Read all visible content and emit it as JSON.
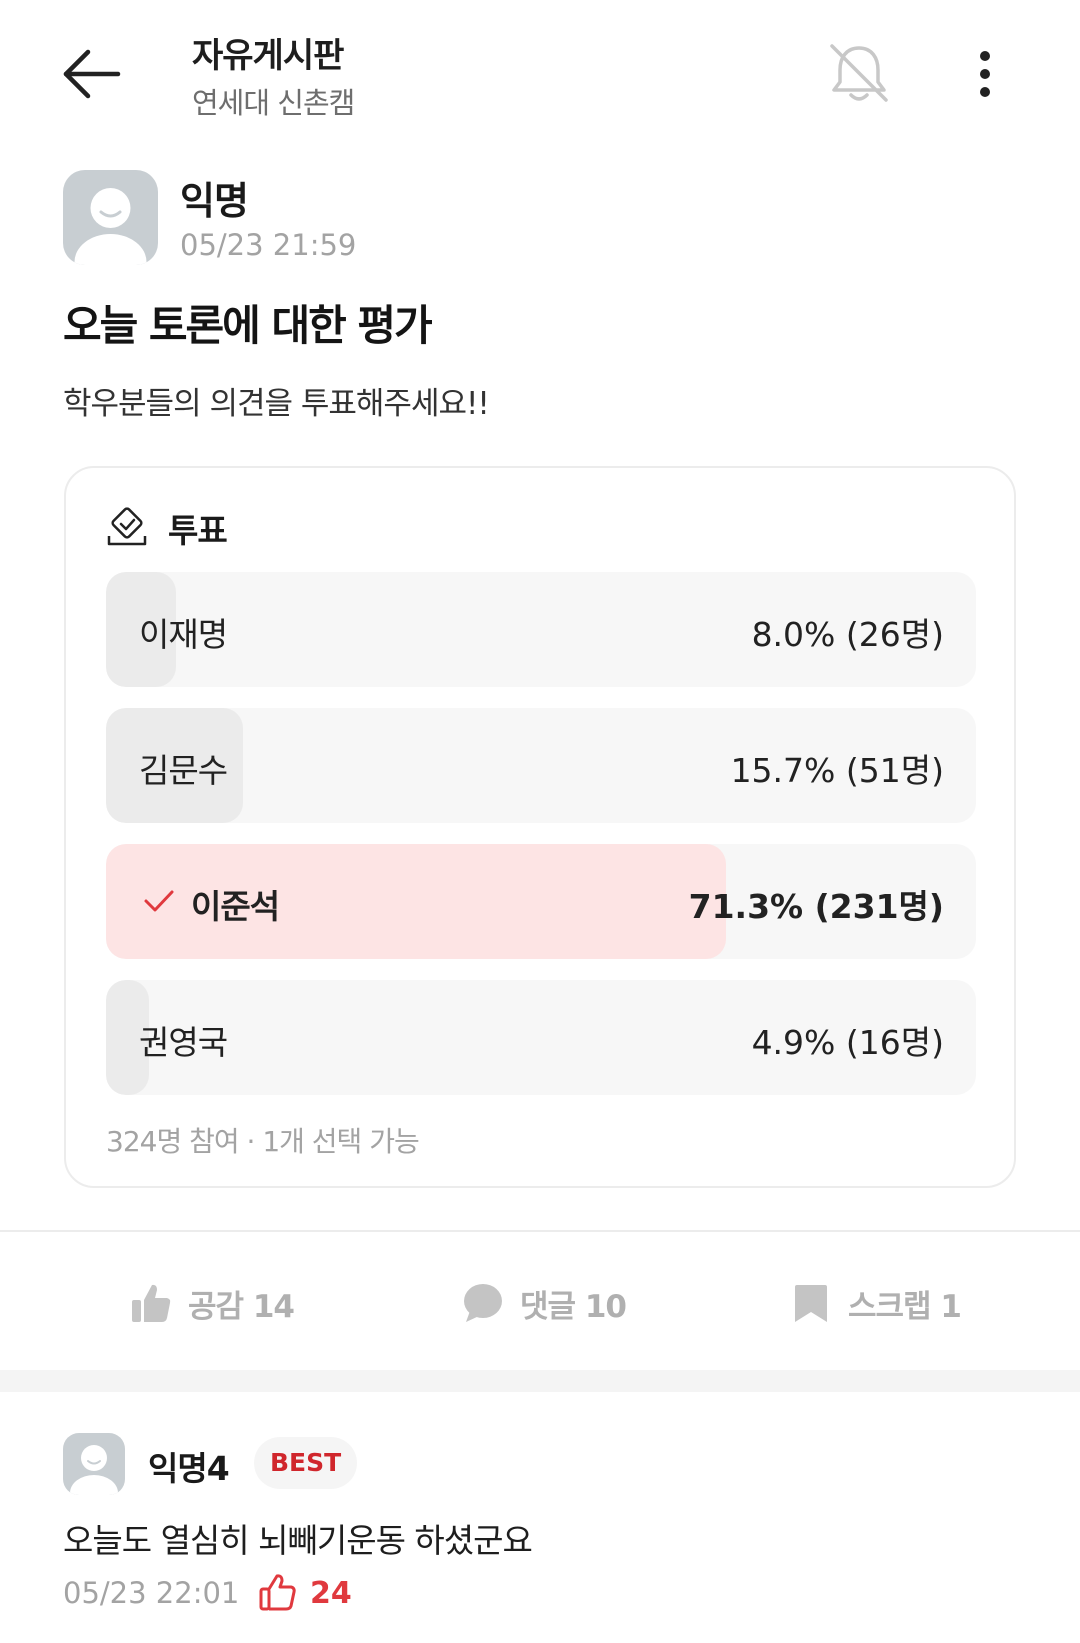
{
  "header": {
    "title": "자유게시판",
    "subtitle": "연세대 신촌캠",
    "icons": [
      "back-arrow-icon",
      "bell-off-icon",
      "more-vertical-icon"
    ]
  },
  "post": {
    "author": "익명",
    "time": "05/23 21:59",
    "title": "오늘 토론에 대한 평가",
    "body": "학우분들의 의견을 투표해주세요!!"
  },
  "poll": {
    "label": "투표",
    "icon": "ballot-box-icon",
    "options": [
      {
        "name": "이재명",
        "result": "8.0% (26명)",
        "percent": 8.0,
        "selected": false
      },
      {
        "name": "김문수",
        "result": "15.7% (51명)",
        "percent": 15.7,
        "selected": false
      },
      {
        "name": "이준석",
        "result": "71.3% (231명)",
        "percent": 71.3,
        "selected": true
      },
      {
        "name": "권영국",
        "result": "4.9% (16명)",
        "percent": 4.9,
        "selected": false
      }
    ],
    "footer": "324명 참여 · 1개 선택 가능"
  },
  "actions": {
    "like": "공감 14",
    "comment": "댓글 10",
    "scrap": "스크랩 1"
  },
  "comment": {
    "author": "익명4",
    "badge": "BEST",
    "body": "오늘도 열심히 뇌빼기운동 하셨군요",
    "time": "05/23 22:01",
    "likes": "24"
  },
  "colors": {
    "accent": "#e0393e",
    "selected_fill": "#fde4e4",
    "muted": "#a3a3a3"
  }
}
